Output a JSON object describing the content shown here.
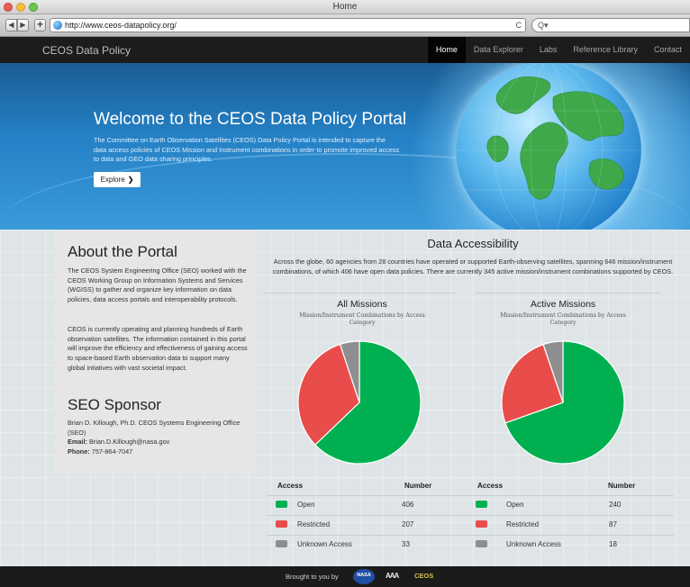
{
  "window": {
    "title": "Home",
    "url": "http://www.ceos-datapolicy.org/"
  },
  "toolbar": {
    "back": "◀",
    "forward": "▶",
    "add": "+",
    "reload": "C",
    "search_placeholder": "Q▾"
  },
  "nav": {
    "brand": "CEOS Data Policy",
    "links": [
      "Home",
      "Data Explorer",
      "Labs",
      "Reference Library",
      "Contact"
    ],
    "active": "Home"
  },
  "hero": {
    "title": "Welcome to the CEOS Data Policy Portal",
    "text": "The Committee on Earth Observation Satellites (CEOS) Data Policy Portal is intended to capture the data access policies of CEOS Mission and Instrument combinations in order to promote improved access to data and GEO data sharing principles.",
    "button": "Explore",
    "button_icon": "chevron-right-icon"
  },
  "about": {
    "title": "About the Portal",
    "p1": "The CEOS System Engineering Office (SEO) worked with the CEOS Working Group on Information Systems and Services (WGISS) to gather and organize key information on data policies, data access portals and interoperability protocols.",
    "p2": "CEOS is currently operating and planning hundreds of Earth observation satellites. The information contained in this portal will improve the efficiency and effectiveness of gaining access to space-based Earth observation data to support many global intiatives with vast societal impact."
  },
  "sponsor": {
    "title": "SEO Sponsor",
    "name": "Brian D. Killough, Ph.D. CEOS Systems Engineering Office (SEO)",
    "email_label": "Email:",
    "email": "Brian.D.Killough@nasa.gov",
    "phone_label": "Phone:",
    "phone": "757-864-7047"
  },
  "accessibility": {
    "title": "Data Accessibility",
    "text": "Across the globe, 60 agencies from 28 countries have operated or supported Earth-observing satellites, spanning 646 mission/instrument combinations, of which 406 have open data policies. There are currently 345 active mission/instrument combinations supported by CEOS.",
    "col_access": "Access",
    "col_number": "Number"
  },
  "colors": {
    "open": "#00b050",
    "restricted": "#e84c4b",
    "unknown": "#8e8e8e",
    "nav_bg": "#1c1c1c"
  },
  "chart_data": [
    {
      "type": "pie",
      "title": "All Missions",
      "subtitle": "Mission/Instrument Combinations by Access Category",
      "categories": [
        "Open",
        "Restricted",
        "Unknown Access"
      ],
      "values": [
        406,
        207,
        33
      ]
    },
    {
      "type": "pie",
      "title": "Active Missions",
      "subtitle": "Mission/Instrument Combinations by Access Category",
      "categories": [
        "Open",
        "Restricted",
        "Unknown Access"
      ],
      "values": [
        240,
        87,
        18
      ]
    }
  ],
  "footer": {
    "text": "Brought to you by",
    "logos": [
      "NASA",
      "AAA",
      "CEOS"
    ]
  }
}
